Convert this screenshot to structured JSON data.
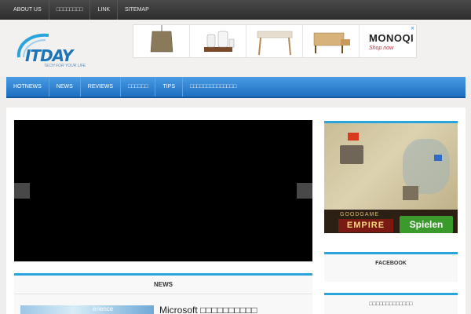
{
  "topbar": {
    "items": [
      "ABOUT US",
      "□□□□□□□□",
      "LINK",
      "SITEMAP"
    ]
  },
  "header": {
    "logo_text": "ITDAY",
    "logo_tagline": "TECH FOR YOUR LIFE",
    "ad": {
      "brand": "MONOQI",
      "cta": "Shop now",
      "close_icon": "close-icon"
    }
  },
  "mainnav": {
    "items": [
      "HOTNEWS",
      "NEWS",
      "REVIEWS",
      "□□□□□□",
      "TIPS",
      "□□□□□□□□□□□□□□"
    ]
  },
  "news": {
    "title": "NEWS",
    "thumb_text": "erience",
    "headline": "Microsoft □□□□□□□□□□"
  },
  "sidebar": {
    "ad": {
      "brand": "GOODGAME",
      "game": "EMPIRE",
      "cta": "Spielen"
    },
    "widgets": [
      {
        "title": "FACEBOOK"
      },
      {
        "title": "□□□□□□□□□□□□□"
      }
    ]
  },
  "colors": {
    "accent": "#29a4dc",
    "nav_blue": "#1e6fc0",
    "topbar": "#3a3a3a"
  }
}
